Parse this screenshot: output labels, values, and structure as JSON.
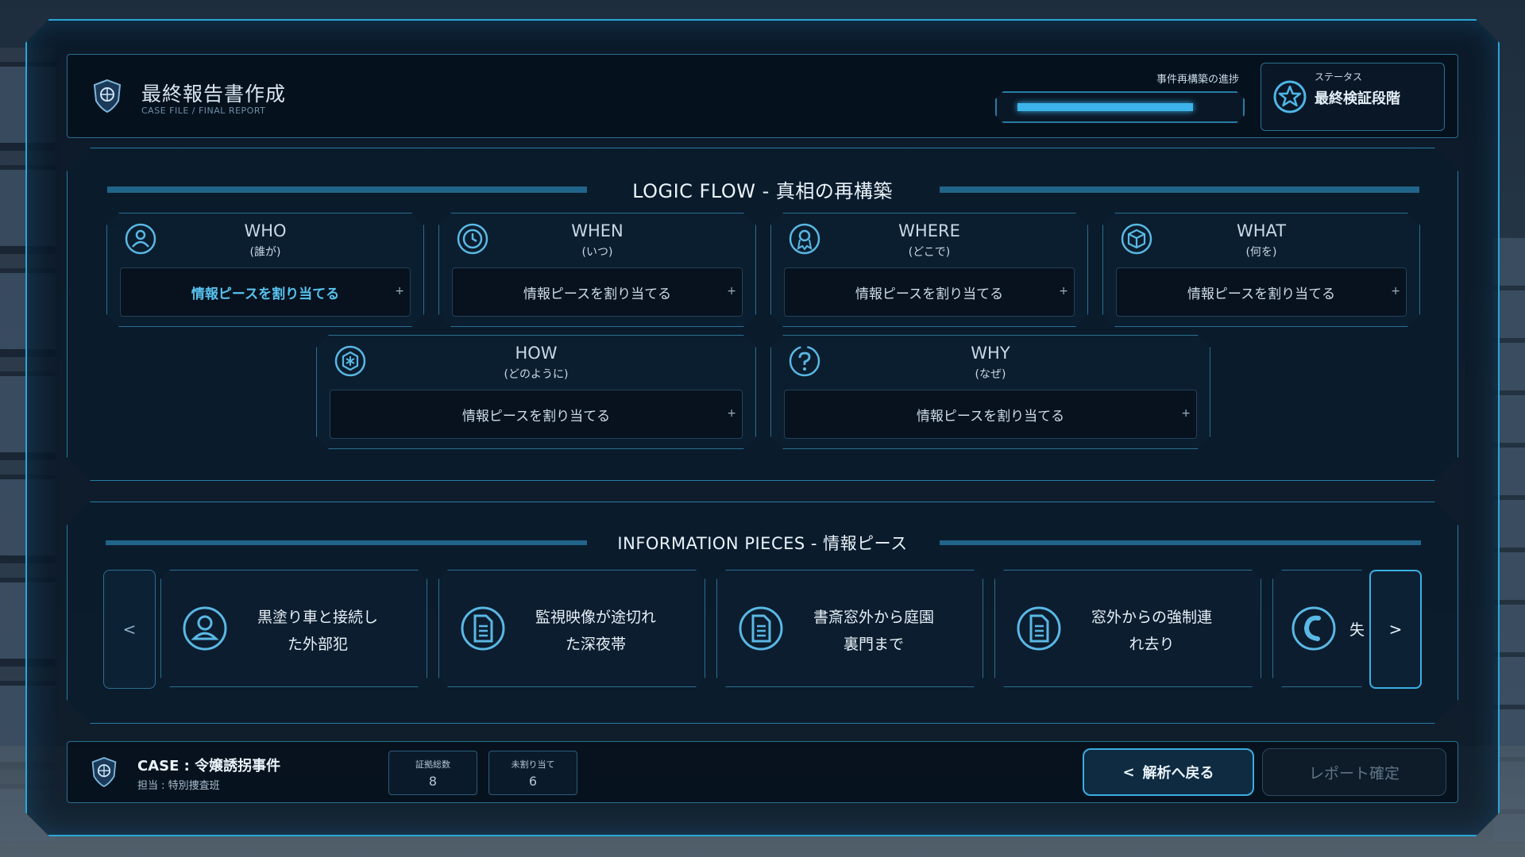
{
  "header": {
    "title": "最終報告書作成",
    "subtitle": "CASE FILE / FINAL REPORT",
    "progress_label": "事件再構築の進捗",
    "progress_fraction": 0.85,
    "status_label": "ステータス",
    "status_value": "最終検証段階"
  },
  "logic_flow": {
    "title": "LOGIC FLOW - 真相の再構築",
    "slot_label": "情報ピースを割り当てる",
    "plus": "+",
    "cards": [
      {
        "name": "WHO",
        "sub": "(誰が)",
        "icon": "person-icon",
        "slot": "情報ピースを割り当てる",
        "active": true
      },
      {
        "name": "WHEN",
        "sub": "(いつ)",
        "icon": "clock-icon",
        "slot": "情報ピースを割り当てる",
        "active": false
      },
      {
        "name": "WHERE",
        "sub": "(どこで)",
        "icon": "location-pin-icon",
        "slot": "情報ピースを割り当てる",
        "active": false
      },
      {
        "name": "WHAT",
        "sub": "(何を)",
        "icon": "cube-icon",
        "slot": "情報ピースを割り当てる",
        "active": false
      },
      {
        "name": "HOW",
        "sub": "(どのように)",
        "icon": "gear-hex-icon",
        "slot": "情報ピースを割り当てる",
        "active": false
      },
      {
        "name": "WHY",
        "sub": "(なぜ)",
        "icon": "question-icon",
        "slot": "情報ピースを割り当てる",
        "active": false
      }
    ]
  },
  "pieces": {
    "title": "INFORMATION PIECES - 情報ピース",
    "prev": "<",
    "next": ">",
    "items": [
      {
        "line1": "黒塗り車と接続し",
        "line2": "た外部犯",
        "icon": "person-icon"
      },
      {
        "line1": "監視映像が途切れ",
        "line2": "た深夜帯",
        "icon": "document-icon"
      },
      {
        "line1": "書斎窓外から庭園",
        "line2": "裏門まで",
        "icon": "document-icon"
      },
      {
        "line1": "窓外からの強制連",
        "line2": "れ去り",
        "icon": "document-icon"
      },
      {
        "line1": "失",
        "line2": "",
        "icon": "phone-icon"
      }
    ]
  },
  "footer": {
    "case": "CASE : 令嬢誘拐事件",
    "owner": "担当 : 特別捜査班",
    "stats": [
      {
        "label": "証拠総数",
        "value": "8"
      },
      {
        "label": "未割り当て",
        "value": "6"
      }
    ],
    "back_label": "解析へ戻る",
    "back_icon": "<",
    "confirm_label": "レポート確定"
  },
  "colors": {
    "accent": "#3cb4ea",
    "panel_border": "#2a7ba4",
    "active_text": "#58c2ee"
  }
}
